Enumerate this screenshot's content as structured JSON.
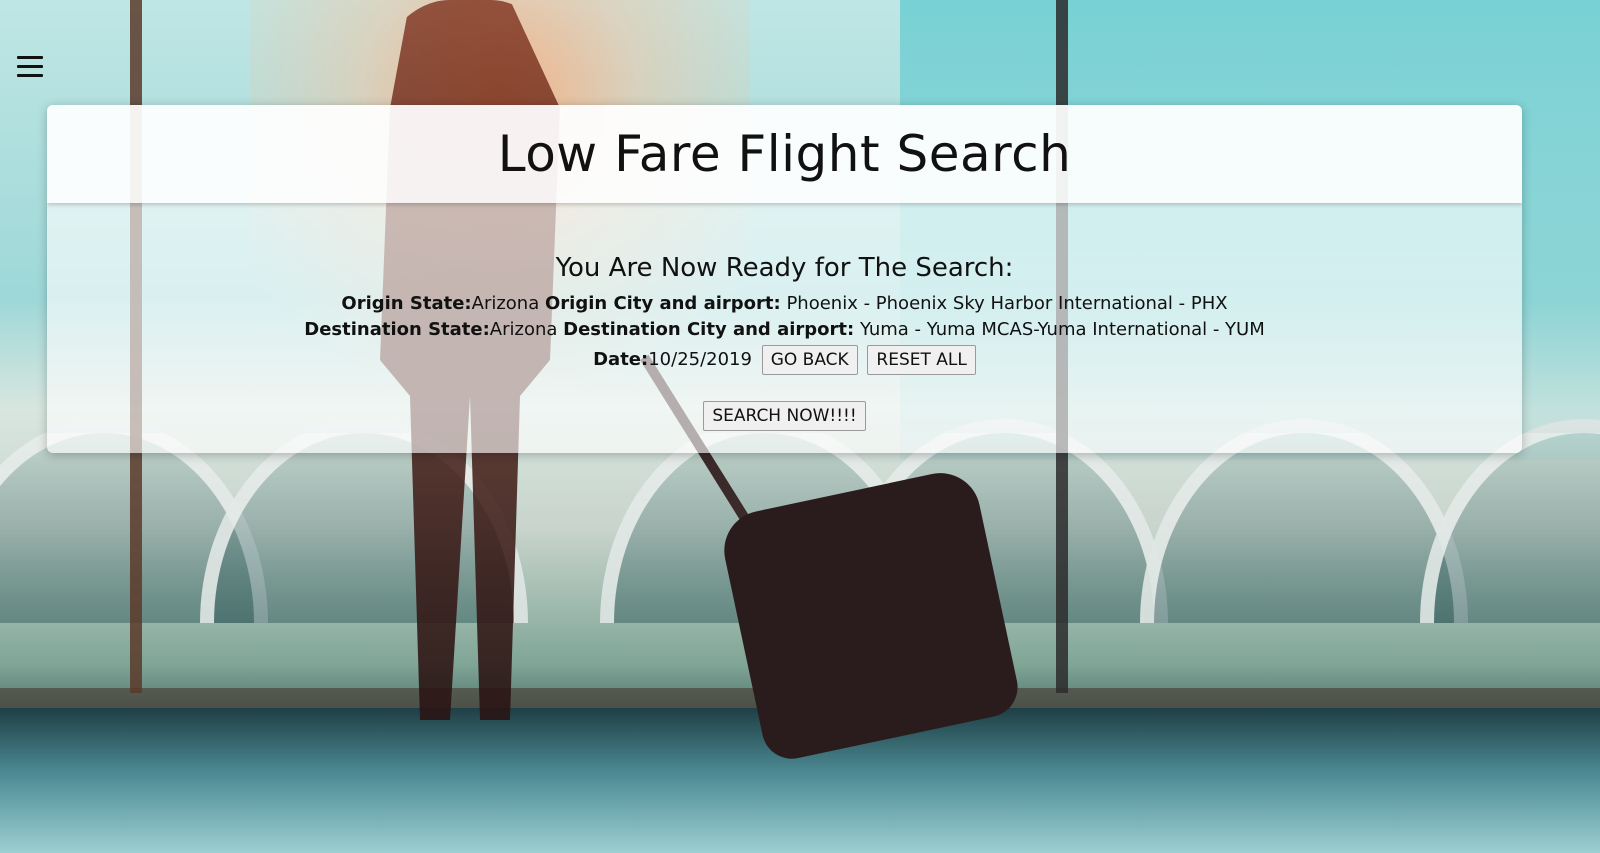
{
  "header": {
    "title": "Low Fare Flight Search",
    "menu_icon": "hamburger-icon"
  },
  "summary": {
    "heading": "You Are Now Ready for The Search:",
    "origin_state_label": "Origin State:",
    "origin_state_value": "Arizona",
    "origin_city_label": "Origin City and airport:",
    "origin_city_value": "Phoenix - Phoenix Sky Harbor International - PHX",
    "destination_state_label": "Destination State:",
    "destination_state_value": "Arizona",
    "destination_city_label": "Destination City and airport:",
    "destination_city_value": "Yuma - Yuma MCAS-Yuma International - YUM",
    "date_label": "Date:",
    "date_value": "10/25/2019"
  },
  "buttons": {
    "go_back": "GO BACK",
    "reset_all": "RESET ALL",
    "search_now": "SEARCH NOW!!!!"
  },
  "colors": {
    "card_bg": "#ffffff",
    "text": "#111111"
  }
}
